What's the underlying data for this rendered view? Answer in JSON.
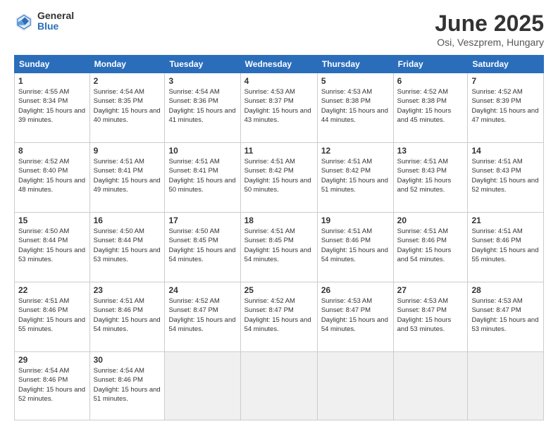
{
  "logo": {
    "general": "General",
    "blue": "Blue"
  },
  "title": "June 2025",
  "location": "Osi, Veszprem, Hungary",
  "days_of_week": [
    "Sunday",
    "Monday",
    "Tuesday",
    "Wednesday",
    "Thursday",
    "Friday",
    "Saturday"
  ],
  "weeks": [
    [
      {
        "day": 1,
        "sunrise": "4:55 AM",
        "sunset": "8:34 PM",
        "daylight": "15 hours and 39 minutes."
      },
      {
        "day": 2,
        "sunrise": "4:54 AM",
        "sunset": "8:35 PM",
        "daylight": "15 hours and 40 minutes."
      },
      {
        "day": 3,
        "sunrise": "4:54 AM",
        "sunset": "8:36 PM",
        "daylight": "15 hours and 41 minutes."
      },
      {
        "day": 4,
        "sunrise": "4:53 AM",
        "sunset": "8:37 PM",
        "daylight": "15 hours and 43 minutes."
      },
      {
        "day": 5,
        "sunrise": "4:53 AM",
        "sunset": "8:38 PM",
        "daylight": "15 hours and 44 minutes."
      },
      {
        "day": 6,
        "sunrise": "4:52 AM",
        "sunset": "8:38 PM",
        "daylight": "15 hours and 45 minutes."
      },
      {
        "day": 7,
        "sunrise": "4:52 AM",
        "sunset": "8:39 PM",
        "daylight": "15 hours and 47 minutes."
      }
    ],
    [
      {
        "day": 8,
        "sunrise": "4:52 AM",
        "sunset": "8:40 PM",
        "daylight": "15 hours and 48 minutes."
      },
      {
        "day": 9,
        "sunrise": "4:51 AM",
        "sunset": "8:41 PM",
        "daylight": "15 hours and 49 minutes."
      },
      {
        "day": 10,
        "sunrise": "4:51 AM",
        "sunset": "8:41 PM",
        "daylight": "15 hours and 50 minutes."
      },
      {
        "day": 11,
        "sunrise": "4:51 AM",
        "sunset": "8:42 PM",
        "daylight": "15 hours and 50 minutes."
      },
      {
        "day": 12,
        "sunrise": "4:51 AM",
        "sunset": "8:42 PM",
        "daylight": "15 hours and 51 minutes."
      },
      {
        "day": 13,
        "sunrise": "4:51 AM",
        "sunset": "8:43 PM",
        "daylight": "15 hours and 52 minutes."
      },
      {
        "day": 14,
        "sunrise": "4:51 AM",
        "sunset": "8:43 PM",
        "daylight": "15 hours and 52 minutes."
      }
    ],
    [
      {
        "day": 15,
        "sunrise": "4:50 AM",
        "sunset": "8:44 PM",
        "daylight": "15 hours and 53 minutes."
      },
      {
        "day": 16,
        "sunrise": "4:50 AM",
        "sunset": "8:44 PM",
        "daylight": "15 hours and 53 minutes."
      },
      {
        "day": 17,
        "sunrise": "4:50 AM",
        "sunset": "8:45 PM",
        "daylight": "15 hours and 54 minutes."
      },
      {
        "day": 18,
        "sunrise": "4:51 AM",
        "sunset": "8:45 PM",
        "daylight": "15 hours and 54 minutes."
      },
      {
        "day": 19,
        "sunrise": "4:51 AM",
        "sunset": "8:46 PM",
        "daylight": "15 hours and 54 minutes."
      },
      {
        "day": 20,
        "sunrise": "4:51 AM",
        "sunset": "8:46 PM",
        "daylight": "15 hours and 54 minutes."
      },
      {
        "day": 21,
        "sunrise": "4:51 AM",
        "sunset": "8:46 PM",
        "daylight": "15 hours and 55 minutes."
      }
    ],
    [
      {
        "day": 22,
        "sunrise": "4:51 AM",
        "sunset": "8:46 PM",
        "daylight": "15 hours and 55 minutes."
      },
      {
        "day": 23,
        "sunrise": "4:51 AM",
        "sunset": "8:46 PM",
        "daylight": "15 hours and 54 minutes."
      },
      {
        "day": 24,
        "sunrise": "4:52 AM",
        "sunset": "8:47 PM",
        "daylight": "15 hours and 54 minutes."
      },
      {
        "day": 25,
        "sunrise": "4:52 AM",
        "sunset": "8:47 PM",
        "daylight": "15 hours and 54 minutes."
      },
      {
        "day": 26,
        "sunrise": "4:53 AM",
        "sunset": "8:47 PM",
        "daylight": "15 hours and 54 minutes."
      },
      {
        "day": 27,
        "sunrise": "4:53 AM",
        "sunset": "8:47 PM",
        "daylight": "15 hours and 53 minutes."
      },
      {
        "day": 28,
        "sunrise": "4:53 AM",
        "sunset": "8:47 PM",
        "daylight": "15 hours and 53 minutes."
      }
    ],
    [
      {
        "day": 29,
        "sunrise": "4:54 AM",
        "sunset": "8:46 PM",
        "daylight": "15 hours and 52 minutes."
      },
      {
        "day": 30,
        "sunrise": "4:54 AM",
        "sunset": "8:46 PM",
        "daylight": "15 hours and 51 minutes."
      },
      null,
      null,
      null,
      null,
      null
    ]
  ]
}
